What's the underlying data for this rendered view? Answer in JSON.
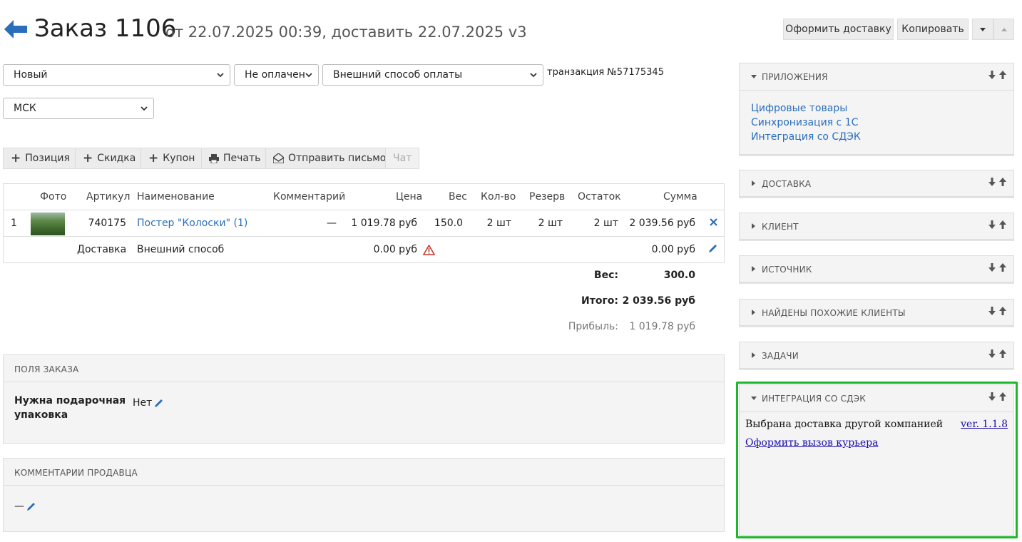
{
  "header": {
    "title": "Заказ 1106",
    "subtitle": "от 22.07.2025 00:39, доставить 22.07.2025",
    "version": "v3",
    "btn_delivery": "Оформить доставку",
    "btn_copy": "Копировать"
  },
  "selects": {
    "status": "Новый",
    "payment_status": "Не оплачен",
    "payment_method": "Внешний способ оплаты",
    "transaction": "транзакция №57175345",
    "region": "МСК"
  },
  "toolbar": {
    "position": "Позиция",
    "discount": "Скидка",
    "coupon": "Купон",
    "print": "Печать",
    "send_email": "Отправить письмо",
    "chat": "Чат"
  },
  "table": {
    "headers": {
      "photo": "Фото",
      "sku": "Артикул",
      "name": "Наименование",
      "comment": "Комментарий",
      "price": "Цена",
      "weight": "Вес",
      "qty": "Кол-во",
      "reserve": "Резерв",
      "stock": "Остаток",
      "sum": "Сумма"
    },
    "item": {
      "num": "1",
      "sku": "740175",
      "name": "Постер \"Колоски\" (1)",
      "comment": "—",
      "price": "1 019.78 руб",
      "weight": "150.0",
      "qty": "2 шт",
      "reserve": "2 шт",
      "stock": "2 шт",
      "sum": "2 039.56 руб"
    },
    "delivery": {
      "label": "Доставка",
      "method": "Внешний способ",
      "price": "0.00 руб",
      "sum": "0.00 руб"
    }
  },
  "summary": {
    "weight_label": "Вес:",
    "weight_value": "300.0",
    "total_label": "Итого:",
    "total_value": "2 039.56 руб",
    "profit_label": "Прибыль:",
    "profit_value": "1 019.78 руб"
  },
  "order_fields": {
    "header": "ПОЛЯ ЗАКАЗА",
    "gift_label_line1": "Нужна подарочная",
    "gift_label_line2": "упаковка",
    "gift_value": "Нет"
  },
  "seller_comments": {
    "header": "КОММЕНТАРИИ ПРОДАВЦА",
    "value": "—"
  },
  "sidebar": {
    "apps": {
      "header": "ПРИЛОЖЕНИЯ",
      "links": [
        "Цифровые товары",
        "Синхронизация с 1С",
        "Интеграция со СДЭК"
      ]
    },
    "delivery": "ДОСТАВКА",
    "client": "КЛИЕНТ",
    "source": "ИСТОЧНИК",
    "similar": "НАЙДЕНЫ ПОХОЖИЕ КЛИЕНТЫ",
    "tasks": "ЗАДАЧИ",
    "sdek": {
      "header": "ИНТЕГРАЦИЯ СО СДЭК",
      "text": "Выбрана доставка другой компанией",
      "version": "ver. 1.1.8",
      "courier_link": "Оформить вызов курьера"
    }
  },
  "colors": {
    "accent": "#2a6ebb",
    "highlight": "#1db82a",
    "warning": "#c0392b"
  }
}
